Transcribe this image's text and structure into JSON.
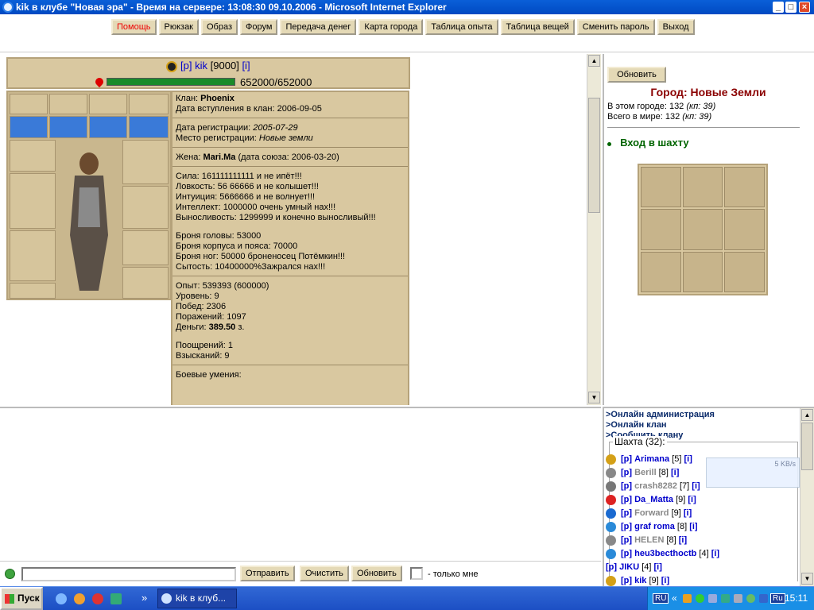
{
  "window": {
    "title": "kik в клубе \"Новая эра\" - Время на сервере: 13:08:30 09.10.2006 - Microsoft Internet Explorer"
  },
  "menu": {
    "buttons": [
      "Помощь",
      "Рюкзак",
      "Образ",
      "Форум",
      "Передача денег",
      "Карта города",
      "Таблица опыта",
      "Таблица вещей",
      "Сменить пароль",
      "Выход"
    ]
  },
  "character": {
    "tag": "[р]",
    "name": "kik",
    "level_badge": "[9000]",
    "info": "[i]",
    "hp": "652000/652000",
    "hp_fraction": 1.0
  },
  "stats": {
    "clan_label": "Клан:",
    "clan": "Phoenix",
    "clan_joined": "Дата вступления в клан: 2006-09-05",
    "reg_date_label": "Дата регистрации:",
    "reg_date": "2005-07-29",
    "reg_place_label": "Место регистрации:",
    "reg_place": "Новые земли",
    "wife_label": "Жена:",
    "wife": "Mari.Ma",
    "wife_date": "(дата союза: 2006-03-20)",
    "attr_lines": [
      "Сила: 161111111111 и не ипёт!!!",
      "Ловкость: 56 66666 и не колышет!!!",
      "Интуиция: 5666666 и не волнует!!!",
      "Интеллект: 1000000 очень умный нах!!!",
      "Выносливость: 1299999 и конечно выносливый!!!"
    ],
    "armor_lines": [
      "Броня головы: 53000",
      "Броня корпуса и пояса: 70000",
      "Броня ног: 50000 броненосец Потёмкин!!!",
      "Сытость: 10400000%Зажрался нах!!!"
    ],
    "exp_lines": [
      "Опыт: 539393 (600000)",
      "Уровень: 9",
      "Побед: 2306",
      "Поражений: 1097"
    ],
    "money_label": "Деньги:",
    "money": "389.50",
    "money_unit": "з.",
    "reward_lines": [
      "Поощрений: 1",
      "Взысканий: 9"
    ],
    "skills_label": "Боевые умения:"
  },
  "right": {
    "refresh_button": "Обновить",
    "city": "Город: Новые Земли",
    "in_city": "В этом городе: 132",
    "in_city_kp": "(кп: 39)",
    "in_world": "Всего в мире: 132",
    "in_world_kp": "(кп: 39)",
    "mine_link": "Вход в шахту"
  },
  "online": {
    "links": [
      ">Онлайн администрация",
      ">Онлайн клан",
      ">Сообщить клану"
    ],
    "section": "Шахта (32):",
    "traffic": "5 KB/s",
    "players": [
      {
        "icon": "phoenix-icon",
        "tag": "[р]",
        "name": "Arimana",
        "lvl": "[5]",
        "info": "[i]",
        "grey": false
      },
      {
        "icon": "dots-icon",
        "tag": "[р]",
        "name": "Berill",
        "lvl": "[8]",
        "info": "[i]",
        "grey": true
      },
      {
        "icon": "sword-icon",
        "tag": "[р]",
        "name": "crash8282",
        "lvl": "[7]",
        "info": "[i]",
        "grey": true
      },
      {
        "icon": "wheelchair-icon",
        "tag": "[р]",
        "name": "Da_Matta",
        "lvl": "[9]",
        "info": "[i]",
        "grey": false
      },
      {
        "icon": "t-icon",
        "tag": "[р]",
        "name": "Forward",
        "lvl": "[9]",
        "info": "[i]",
        "grey": true
      },
      {
        "icon": "fish-icon",
        "tag": "[р]",
        "name": "graf roma",
        "lvl": "[8]",
        "info": "[i]",
        "grey": false
      },
      {
        "icon": "dots-icon",
        "tag": "[р]",
        "name": "HELEN",
        "lvl": "[8]",
        "info": "[i]",
        "grey": true
      },
      {
        "icon": "fish-icon",
        "tag": "[р]",
        "name": "heu3becthoctb",
        "lvl": "[4]",
        "info": "[i]",
        "grey": false
      },
      {
        "icon": "",
        "tag": "[р]",
        "name": "JIKU",
        "lvl": "[4]",
        "info": "[i]",
        "grey": false
      },
      {
        "icon": "phoenix-icon",
        "tag": "[р]",
        "name": "kik",
        "lvl": "[9]",
        "info": "[i]",
        "grey": false
      }
    ]
  },
  "chat": {
    "send": "Отправить",
    "clear": "Очистить",
    "refresh": "Обновить",
    "only_me": "- только мне"
  },
  "taskbar": {
    "start": "Пуск",
    "window": "kik в клуб...",
    "lang": "RU",
    "lang2": "Ru",
    "clock": "15:11",
    "more": "»",
    "tray_more": "«"
  }
}
